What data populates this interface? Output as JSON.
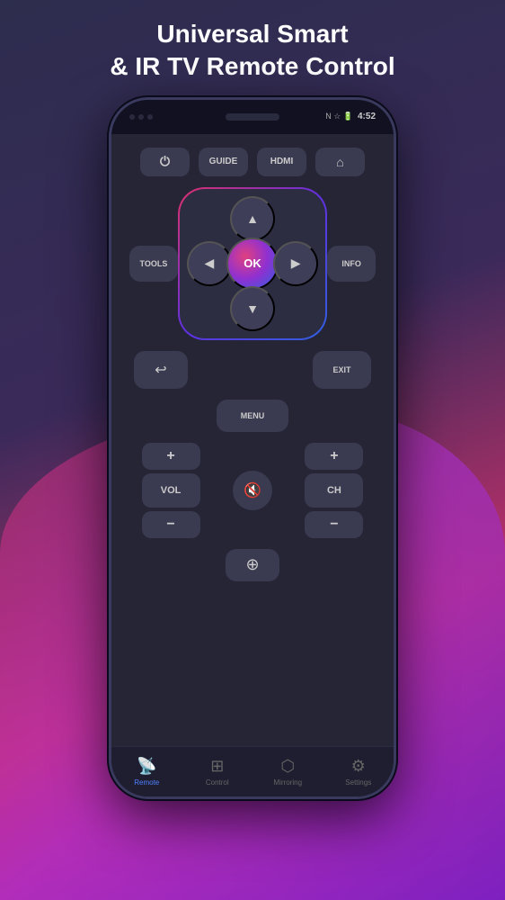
{
  "header": {
    "title": "Universal Smart\n& IR TV Remote Control"
  },
  "phone": {
    "status_bar": {
      "time": "4:52",
      "wifi": "wifi",
      "battery": "battery"
    }
  },
  "remote": {
    "top_buttons": [
      {
        "label": "⏻",
        "id": "power"
      },
      {
        "label": "GUIDE",
        "id": "guide"
      },
      {
        "label": "HDMI",
        "id": "hdmi"
      },
      {
        "label": "⌂",
        "id": "home"
      }
    ],
    "side_left": "TOOLS",
    "side_right": "INFO",
    "nav": {
      "up": "▲",
      "down": "▼",
      "left": "◀",
      "right": "▶",
      "ok": "OK"
    },
    "back": "↩",
    "exit": "EXIT",
    "menu": "MENU",
    "vol_plus": "+",
    "vol_label": "VOL",
    "vol_minus": "−",
    "mute": "🔇",
    "ch_plus": "+",
    "ch_label": "CH",
    "ch_minus": "−",
    "source": "⊕"
  },
  "bottom_nav": [
    {
      "label": "Remote",
      "icon": "📡",
      "active": true
    },
    {
      "label": "Control",
      "icon": "⊞",
      "active": false
    },
    {
      "label": "Mirroring",
      "icon": "⬡",
      "active": false
    },
    {
      "label": "Settings",
      "icon": "⚙",
      "active": false
    }
  ]
}
